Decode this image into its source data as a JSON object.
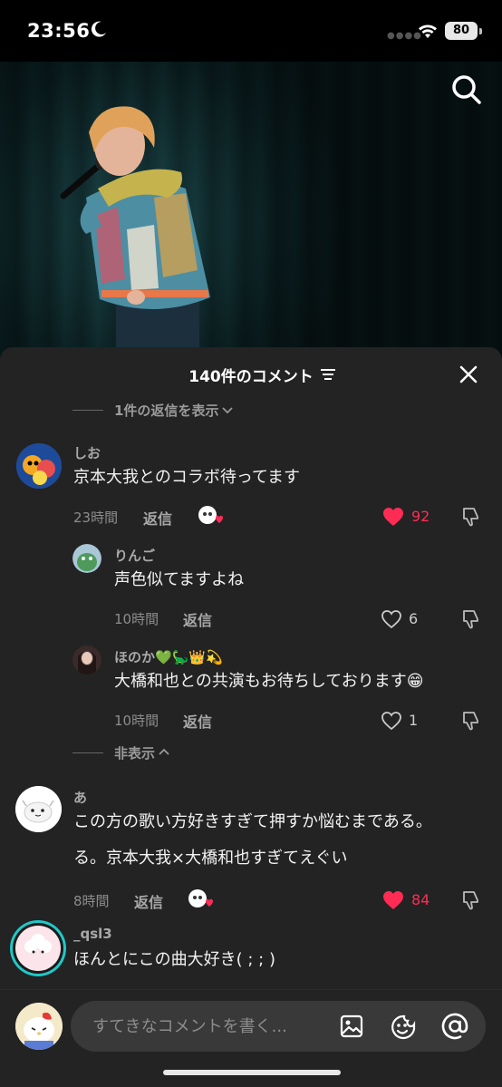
{
  "status_bar": {
    "time": "23:56",
    "battery": "80",
    "icons": [
      "moon-icon",
      "wifi-icon",
      "battery-icon"
    ]
  },
  "video": {
    "icons": [
      "search-icon"
    ]
  },
  "sheet": {
    "title": "140件のコメント"
  },
  "toggles": {
    "show_replies": "1件の返信を表示",
    "hide": "非表示"
  },
  "comments": [
    {
      "user": "しお",
      "text": "京本大我とのコラボ待ってます",
      "time": "23時間",
      "reply": "返信",
      "likes": "92",
      "liked": true,
      "creator_liked": true
    },
    {
      "user": "りんご",
      "text": "声色似てますよね",
      "time": "10時間",
      "reply": "返信",
      "likes": "6",
      "liked": false
    },
    {
      "user": "ほのか💚🦕👑💫",
      "text": "大橋和也との共演もお待ちしております😁",
      "time": "10時間",
      "reply": "返信",
      "likes": "1",
      "liked": false
    },
    {
      "user": "あ",
      "text_line1": "この方の歌い方好きすぎて押すか悩むまである。",
      "text_line2": "る。京本大我×大橋和也すぎてえぐい",
      "time": "8時間",
      "reply": "返信",
      "likes": "84",
      "liked": true,
      "creator_liked": true
    },
    {
      "user": "_qsl3",
      "text": "ほんとにこの曲大好き( ; ; )"
    }
  ],
  "input": {
    "placeholder": "すてきなコメントを書く..."
  },
  "colors": {
    "like_red": "#fe2c55",
    "sheet_bg": "#232323",
    "text": "#f2f2f2",
    "muted": "#8c8c8c"
  }
}
